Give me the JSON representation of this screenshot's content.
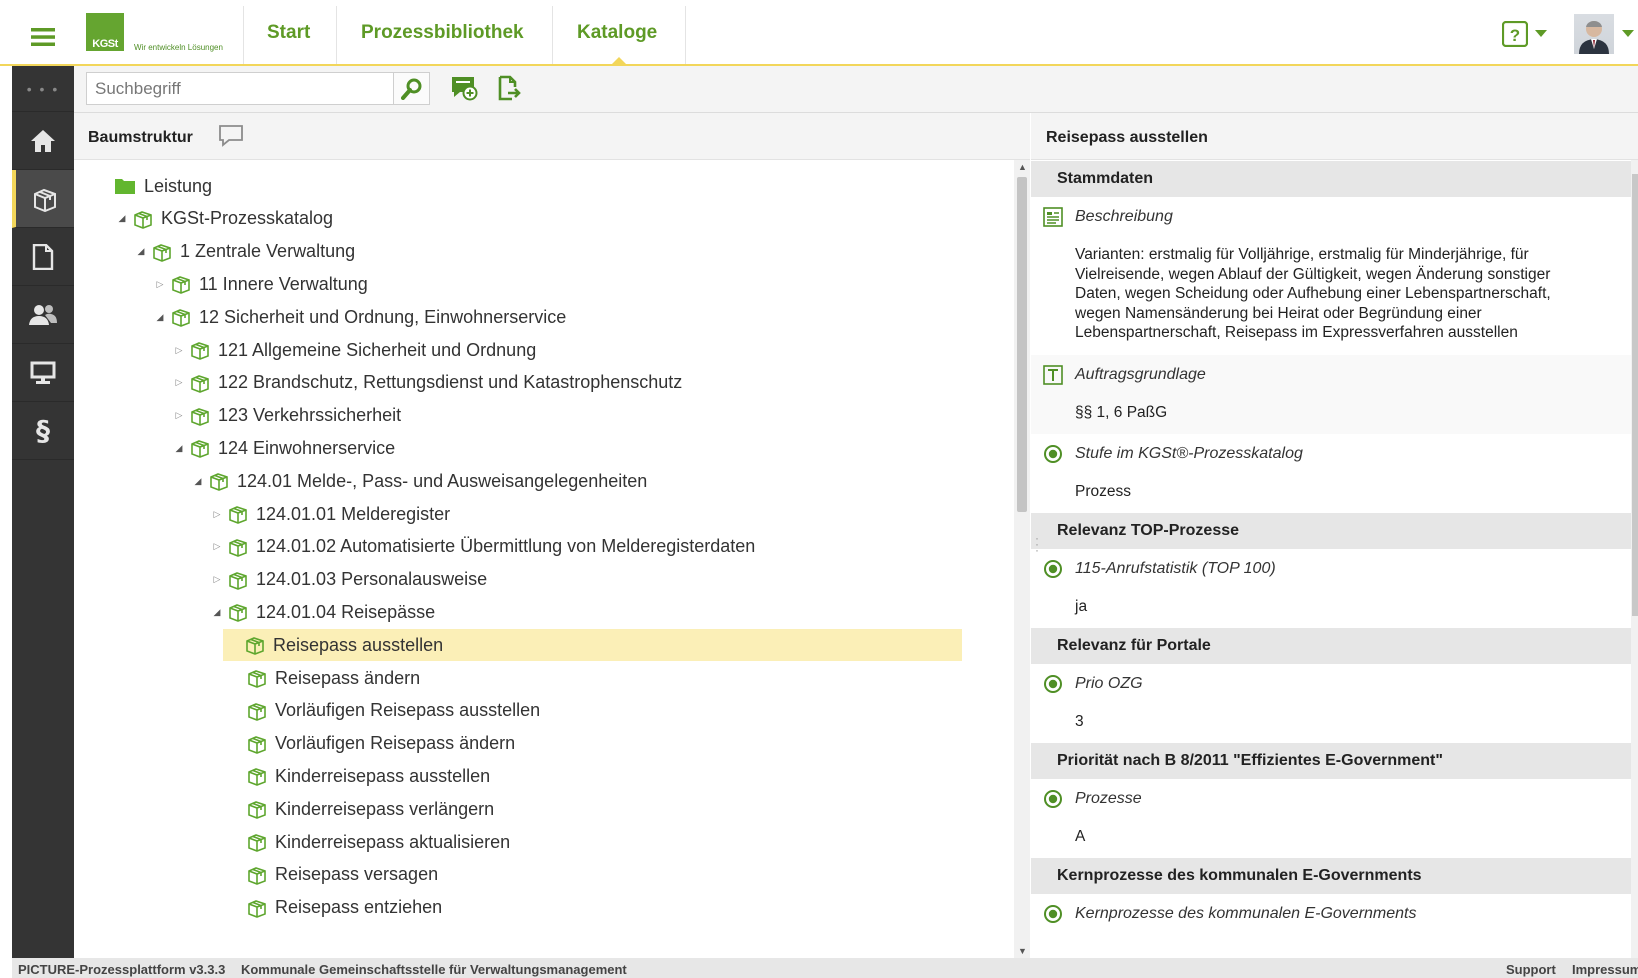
{
  "header": {
    "logo_text": "KGSt",
    "logo_tagline": "Wir entwickeln Lösungen",
    "nav": [
      {
        "label": "Start"
      },
      {
        "label": "Prozessbibliothek"
      },
      {
        "label": "Kataloge",
        "active": true
      }
    ],
    "help_icon": "help-icon",
    "accent_color": "#5e9a26",
    "highlight_color": "#f2d65a"
  },
  "rail": {
    "items": [
      {
        "icon": "dots-icon"
      },
      {
        "icon": "home-icon"
      },
      {
        "icon": "catalog-box-icon",
        "active": true
      },
      {
        "icon": "document-icon"
      },
      {
        "icon": "users-icon"
      },
      {
        "icon": "monitor-icon"
      },
      {
        "icon": "paragraph-icon"
      }
    ]
  },
  "toolbar": {
    "search_placeholder": "Suchbegriff"
  },
  "left_panel": {
    "title": "Baumstruktur"
  },
  "tree": [
    {
      "label": "Leistung",
      "level": 0,
      "type": "folder",
      "toggle": "none"
    },
    {
      "label": "KGSt-Prozesskatalog",
      "level": 1,
      "type": "box",
      "toggle": "expanded"
    },
    {
      "label": "1 Zentrale Verwaltung",
      "level": 2,
      "type": "box",
      "toggle": "expanded"
    },
    {
      "label": "11 Innere Verwaltung",
      "level": 3,
      "type": "box",
      "toggle": "collapsed"
    },
    {
      "label": "12 Sicherheit und Ordnung, Einwohnerservice",
      "level": 3,
      "type": "box",
      "toggle": "expanded"
    },
    {
      "label": "121 Allgemeine Sicherheit und Ordnung",
      "level": 4,
      "type": "box",
      "toggle": "collapsed"
    },
    {
      "label": "122 Brandschutz, Rettungsdienst und Katastrophenschutz",
      "level": 4,
      "type": "box",
      "toggle": "collapsed"
    },
    {
      "label": "123 Verkehrssicherheit",
      "level": 4,
      "type": "box",
      "toggle": "collapsed"
    },
    {
      "label": "124 Einwohnerservice",
      "level": 4,
      "type": "box",
      "toggle": "expanded"
    },
    {
      "label": "124.01 Melde-, Pass- und Ausweisangelegenheiten",
      "level": 5,
      "type": "box",
      "toggle": "expanded"
    },
    {
      "label": "124.01.01 Melderegister",
      "level": 6,
      "type": "box",
      "toggle": "collapsed"
    },
    {
      "label": "124.01.02 Automatisierte Übermittlung von Melderegisterdaten",
      "level": 6,
      "type": "box",
      "toggle": "collapsed"
    },
    {
      "label": "124.01.03 Personalausweise",
      "level": 6,
      "type": "box",
      "toggle": "collapsed"
    },
    {
      "label": "124.01.04 Reisepässe",
      "level": 6,
      "type": "box",
      "toggle": "expanded"
    },
    {
      "label": "Reisepass ausstellen",
      "level": 7,
      "type": "box",
      "toggle": "none",
      "selected": true
    },
    {
      "label": "Reisepass ändern",
      "level": 7,
      "type": "box",
      "toggle": "none"
    },
    {
      "label": "Vorläufigen Reisepass ausstellen",
      "level": 7,
      "type": "box",
      "toggle": "none"
    },
    {
      "label": "Vorläufigen Reisepass ändern",
      "level": 7,
      "type": "box",
      "toggle": "none"
    },
    {
      "label": "Kinderreisepass ausstellen",
      "level": 7,
      "type": "box",
      "toggle": "none"
    },
    {
      "label": "Kinderreisepass verlängern",
      "level": 7,
      "type": "box",
      "toggle": "none"
    },
    {
      "label": "Kinderreisepass aktualisieren",
      "level": 7,
      "type": "box",
      "toggle": "none"
    },
    {
      "label": "Reisepass versagen",
      "level": 7,
      "type": "box",
      "toggle": "none"
    },
    {
      "label": "Reisepass entziehen",
      "level": 7,
      "type": "box",
      "toggle": "none"
    }
  ],
  "detail": {
    "title": "Reisepass ausstellen",
    "sections": [
      {
        "title": "Stammdaten",
        "props": [
          {
            "icon": "text-block-icon",
            "label": "Beschreibung",
            "value_lines": [
              "Varianten: erstmalig für Volljährige, erstmalig für Minderjährige, für",
              "Vielreisende, wegen Ablauf der Gültigkeit, wegen Änderung sonstiger",
              "Daten, wegen Scheidung oder Aufhebung einer Lebenspartnerschaft,",
              "wegen Namensänderung bei Heirat oder Begründung einer",
              "Lebenspartnerschaft, Reisepass im Expressverfahren ausstellen"
            ]
          },
          {
            "icon": "text-t-icon",
            "label": "Auftragsgrundlage",
            "value_lines": [
              "§§ 1, 6 PaßG"
            ]
          },
          {
            "icon": "radio-selected-icon",
            "label": "Stufe im KGSt®-Prozesskatalog",
            "value_lines": [
              "Prozess"
            ]
          }
        ]
      },
      {
        "title": "Relevanz TOP-Prozesse",
        "props": [
          {
            "icon": "radio-selected-icon",
            "label": "115-Anrufstatistik (TOP 100)",
            "value_lines": [
              "ja"
            ]
          }
        ]
      },
      {
        "title": "Relevanz für Portale",
        "props": [
          {
            "icon": "radio-selected-icon",
            "label": "Prio OZG",
            "value_lines": [
              "3"
            ]
          }
        ]
      },
      {
        "title": "Priorität nach B 8/2011 \"Effizientes E-Government\"",
        "props": [
          {
            "icon": "radio-selected-icon",
            "label": "Prozesse",
            "value_lines": [
              "A"
            ]
          }
        ]
      },
      {
        "title": "Kernprozesse des kommunalen E-Governments",
        "props": [
          {
            "icon": "radio-selected-icon",
            "label": "Kernprozesse des kommunalen E-Governments",
            "value_lines": []
          }
        ]
      }
    ]
  },
  "footer": {
    "version": "PICTURE-Prozessplattform v3.3.3",
    "organization": "Kommunale Gemeinschaftsstelle für Verwaltungsmanagement",
    "links": [
      {
        "label": "Support"
      },
      {
        "label": "Impressum"
      }
    ]
  }
}
